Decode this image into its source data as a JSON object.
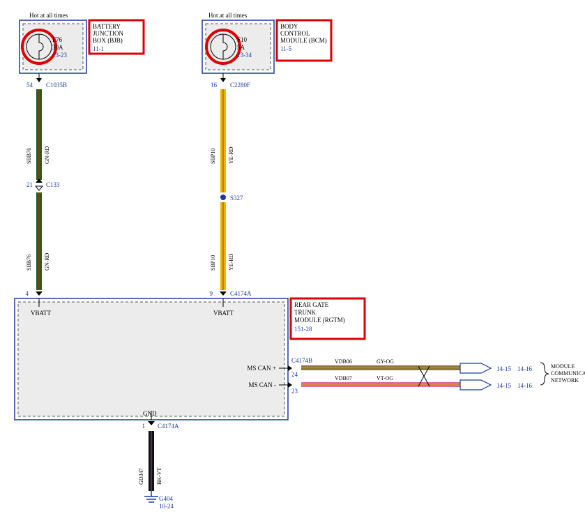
{
  "hot": "Hot at all times",
  "bjb": {
    "title1": "BATTERY",
    "title2": "JUNCTION",
    "title3": "BOX (BJB)",
    "ref": "11-1",
    "fuse": "F76",
    "rating": "30A",
    "dtc": "13-23"
  },
  "bcm": {
    "title1": "BODY",
    "title2": "CONTROL",
    "title3": "MODULE (BCM)",
    "ref": "11-5",
    "fuse": "F10",
    "rating": "5A",
    "dtc": "13-34"
  },
  "conn": {
    "c1035b_pin": "54",
    "c1035b": "C1035B",
    "c133_pin": "21",
    "c133": "C133",
    "c4174a_left_pin": "4",
    "c4174a_top_pin": "9",
    "c4174a": "C4174A",
    "c2280f_pin": "16",
    "c2280f": "C2280F",
    "s327": "S327",
    "c4174b": "C4174B",
    "c4174b_pin1": "24",
    "c4174b_pin2": "23",
    "c4174a_gnd_pin": "1",
    "g404": "G404",
    "g404_ref": "10-24"
  },
  "wire": {
    "sbb76": "SBB76",
    "gnrd": "GN-RD",
    "sbp10": "SBP10",
    "yerd": "YE-RD",
    "gd347": "GD347",
    "bkvt": "BK-VT",
    "vdb06": "VDB06",
    "gyog": "GY-OG",
    "vdb07": "VDB07",
    "vtog": "VT-OG"
  },
  "rgtm": {
    "title1": "REAR GATE",
    "title2": "TRUNK",
    "title3": "MODULE (RGTM)",
    "ref": "151-28",
    "vbatt": "VBATT",
    "mscanp": "MS CAN +",
    "mscanm": "MS CAN -",
    "gnd": "GND"
  },
  "net": {
    "ref1": "14-15",
    "ref2": "14-16",
    "title1": "MODULE",
    "title2": "COMMUNICATIONS",
    "title3": "NETWORK"
  }
}
